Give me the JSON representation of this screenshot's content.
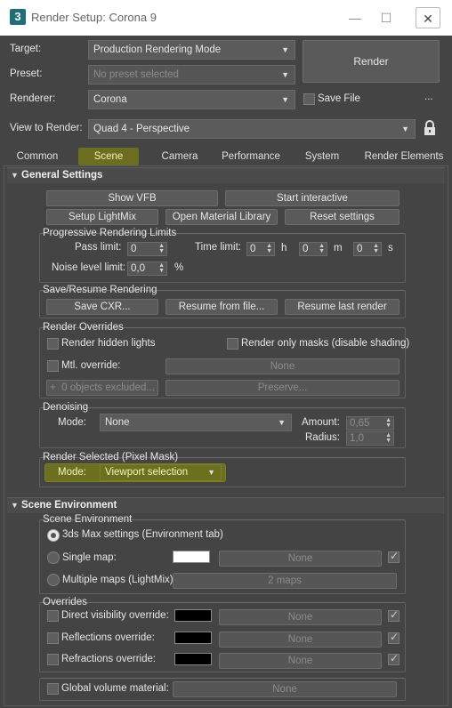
{
  "window": {
    "title": "Render Setup: Corona 9",
    "app_icon_label": "3"
  },
  "top": {
    "target_label": "Target:",
    "target_value": "Production Rendering Mode",
    "preset_label": "Preset:",
    "preset_placeholder": "No preset selected",
    "renderer_label": "Renderer:",
    "renderer_value": "Corona",
    "save_file_label": "Save File",
    "save_file_checked": false,
    "render_button": "Render",
    "more_button": "...",
    "view_label": "View to Render:",
    "view_value": "Quad 4 - Perspective"
  },
  "tabs": [
    "Common",
    "Scene",
    "Camera",
    "Performance",
    "System",
    "Render Elements"
  ],
  "active_tab": "Scene",
  "general": {
    "header": "General Settings",
    "show_vfb": "Show VFB",
    "start_interactive": "Start interactive",
    "setup_lightmix": "Setup LightMix",
    "open_material_library": "Open Material Library",
    "reset_settings": "Reset settings",
    "progressive": {
      "title": "Progressive Rendering Limits",
      "pass_limit_label": "Pass limit:",
      "pass_limit_value": "0",
      "time_limit_label": "Time limit:",
      "time_h": "0",
      "time_m": "0",
      "time_s": "0",
      "unit_h": "h",
      "unit_m": "m",
      "unit_s": "s",
      "noise_label": "Noise level limit:",
      "noise_value": "0,0",
      "noise_unit": "%"
    },
    "save_resume": {
      "title": "Save/Resume Rendering",
      "save_cxr": "Save CXR...",
      "resume_file": "Resume from file...",
      "resume_last": "Resume last render"
    },
    "overrides": {
      "title": "Render Overrides",
      "hidden_lights": "Render hidden lights",
      "only_masks": "Render only masks (disable shading)",
      "mtl_override": "Mtl. override:",
      "mtl_none": "None",
      "plus": "+",
      "excluded": "0 objects excluded...",
      "preserve": "Preserve..."
    },
    "denoising": {
      "title": "Denoising",
      "mode_label": "Mode:",
      "mode_value": "None",
      "amount_label": "Amount:",
      "amount_value": "0,65",
      "radius_label": "Radius:",
      "radius_value": "1,0"
    },
    "pixel_mask": {
      "title": "Render Selected (Pixel Mask)",
      "mode_label": "Mode:",
      "mode_value": "Viewport selection"
    }
  },
  "scene_env": {
    "header": "Scene Environment",
    "group_title": "Scene Environment",
    "opt_3ds": "3ds Max settings (Environment tab)",
    "opt_single": "Single map:",
    "single_none": "None",
    "opt_multiple": "Multiple maps (LightMix):",
    "multiple_value": "2 maps",
    "selected_option": "3ds Max settings (Environment tab)",
    "overrides_title": "Overrides",
    "direct": "Direct visibility override:",
    "reflections": "Reflections override:",
    "refractions": "Refractions override:",
    "none": "None",
    "global_volume": "Global volume material:",
    "global_none": "None"
  },
  "colors": {
    "highlight": "#6b6e1f",
    "background": "#444444",
    "single_map_swatch": "#ffffff",
    "override_swatch": "#000000"
  }
}
